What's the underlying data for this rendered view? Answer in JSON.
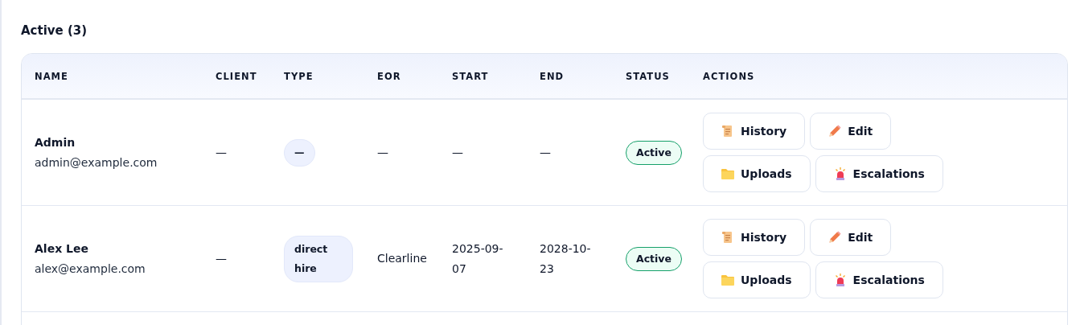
{
  "section": {
    "title": "Active (3)"
  },
  "table": {
    "columns": [
      "NAME",
      "CLIENT",
      "TYPE",
      "EOR",
      "START",
      "END",
      "STATUS",
      "ACTIONS"
    ],
    "rows": [
      {
        "name": "Admin",
        "email": "admin@example.com",
        "client": "—",
        "type": "—",
        "eor": "—",
        "start": "—",
        "end": "—",
        "status": "Active",
        "actions": [
          {
            "kind": "history",
            "label": "History"
          },
          {
            "kind": "edit",
            "label": "Edit"
          },
          {
            "kind": "uploads",
            "label": "Uploads"
          },
          {
            "kind": "escalations",
            "label": "Escalations"
          }
        ]
      },
      {
        "name": "Alex Lee",
        "email": "alex@example.com",
        "client": "—",
        "type": "direct hire",
        "eor": "Clearline",
        "start": "2025-09-07",
        "end": "2028-10-23",
        "status": "Active",
        "actions": [
          {
            "kind": "history",
            "label": "History"
          },
          {
            "kind": "edit",
            "label": "Edit"
          },
          {
            "kind": "uploads",
            "label": "Uploads"
          },
          {
            "kind": "escalations",
            "label": "Escalations"
          }
        ]
      }
    ]
  }
}
